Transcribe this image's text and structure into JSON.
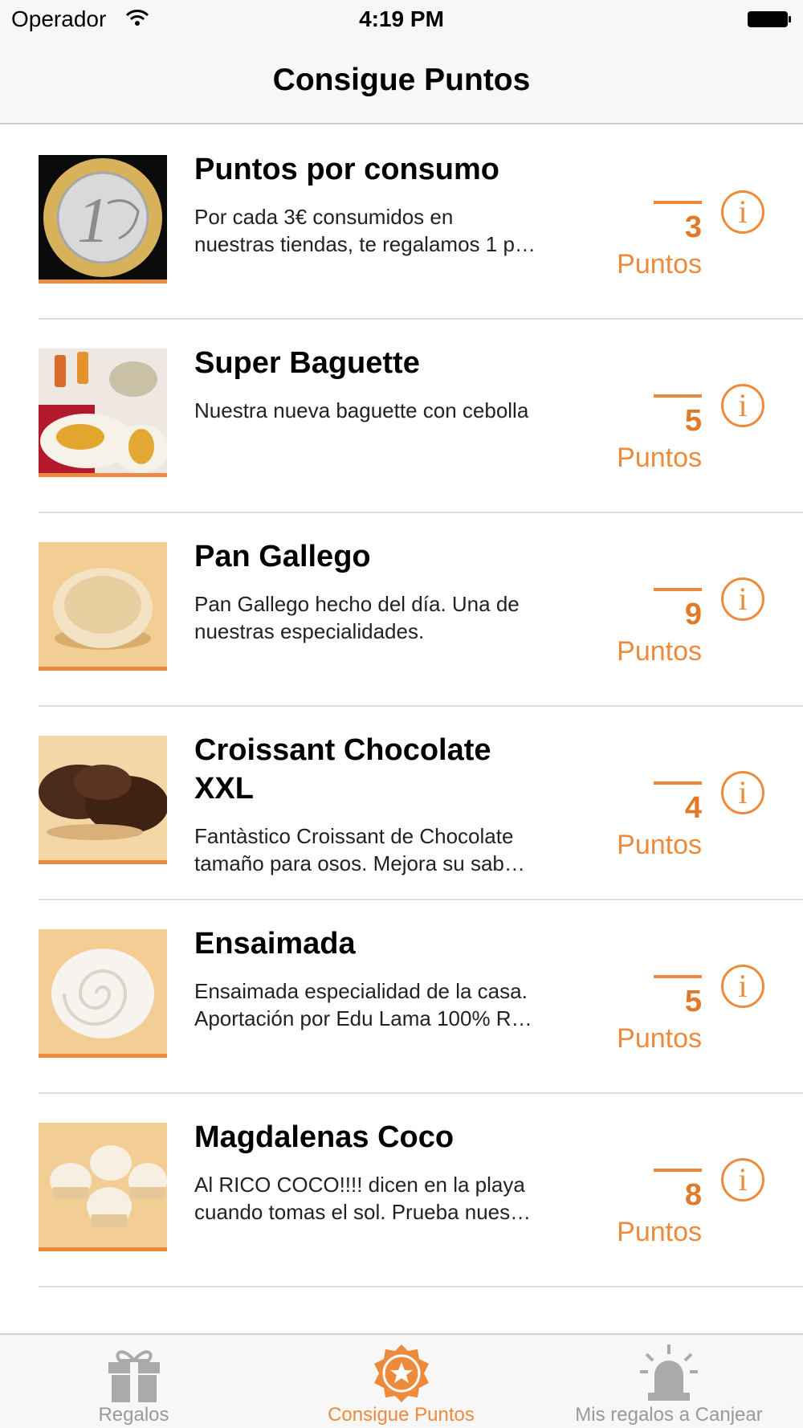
{
  "status_bar": {
    "carrier": "Operador",
    "time": "4:19 PM"
  },
  "nav": {
    "title": "Consigue Puntos"
  },
  "accent_color": "#ee8a3c",
  "items": [
    {
      "title": "Puntos por consumo",
      "desc_lines": [
        "Por cada 3€ consumidos en",
        "nuestras tiendas, te regalamos 1 p…"
      ],
      "points": "3",
      "points_label": "Puntos",
      "image": "euro-coin"
    },
    {
      "title": "Super Baguette",
      "desc_lines": [
        "Nuestra nueva baguette con cebolla"
      ],
      "points": "5",
      "points_label": "Puntos",
      "image": "baguette-tapas"
    },
    {
      "title": "Pan Gallego",
      "desc_lines": [
        "Pan Gallego hecho del día. Una de",
        "nuestras especialidades."
      ],
      "points": "9",
      "points_label": "Puntos",
      "image": "round-bread"
    },
    {
      "title_lines": [
        "Croissant Chocolate",
        "XXL"
      ],
      "desc_lines": [
        "Fantàstico Croissant de Chocolate",
        "tamaño para osos. Mejora su sab…"
      ],
      "points": "4",
      "points_label": "Puntos",
      "image": "chocolate-croissant"
    },
    {
      "title": "Ensaimada",
      "desc_lines": [
        "Ensaimada especialidad de la casa.",
        "Aportación por Edu Lama 100% R…"
      ],
      "points": "5",
      "points_label": "Puntos",
      "image": "ensaimada"
    },
    {
      "title": "Magdalenas Coco",
      "desc_lines": [
        "Al RICO COCO!!!! dicen en la playa",
        "cuando tomas el sol. Prueba nues…"
      ],
      "points": "8",
      "points_label": "Puntos",
      "image": "coconut-muffins"
    }
  ],
  "tabs": [
    {
      "label": "Regalos",
      "icon": "gift-icon",
      "active": false
    },
    {
      "label": "Consigue Puntos",
      "icon": "star-badge-icon",
      "active": true
    },
    {
      "label": "Mis regalos a Canjear",
      "icon": "alarm-icon",
      "active": false
    }
  ]
}
